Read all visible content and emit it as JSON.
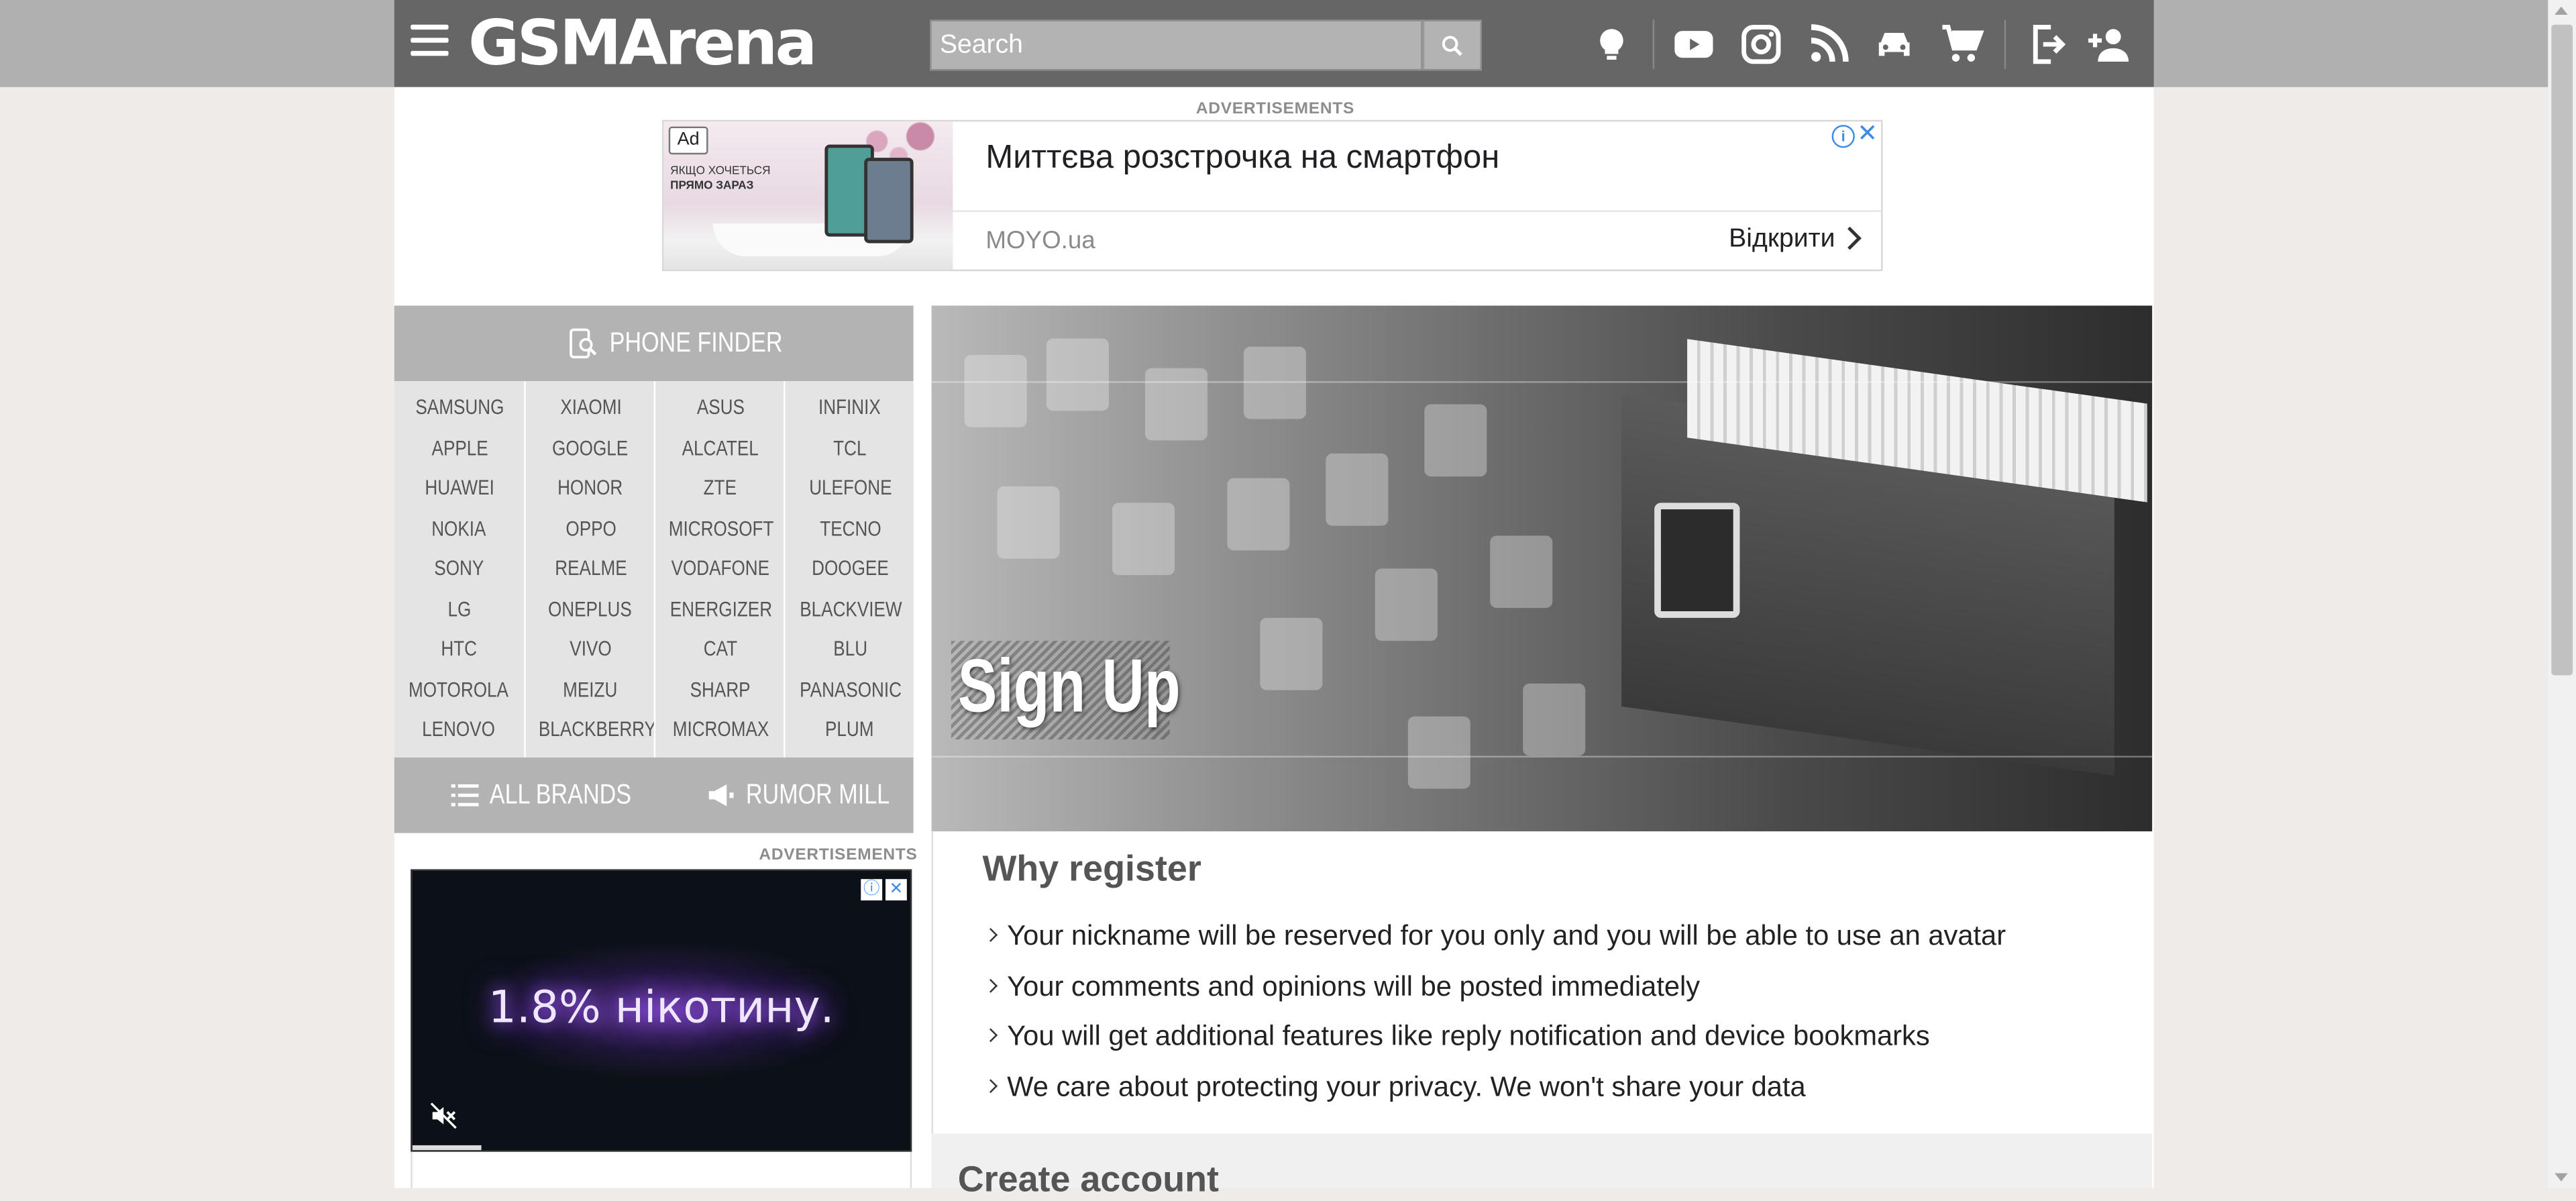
{
  "header": {
    "logo_text": "GSMArena",
    "search_placeholder": "Search",
    "icons": [
      "menu-icon",
      "search-icon",
      "lightbulb-icon",
      "youtube-icon",
      "instagram-icon",
      "rss-icon",
      "car-icon",
      "cart-icon",
      "login-icon",
      "add-user-icon"
    ]
  },
  "top_ad": {
    "label": "ADVERTISEMENTS",
    "badge": "Ad",
    "image_caption_line1": "ЯКЩО ХОЧЕТЬСЯ",
    "image_caption_line2": "ПРЯМО ЗАРАЗ",
    "headline": "Миттєва розстрочка на смартфон",
    "domain": "MOYO.ua",
    "cta": "Відкрити",
    "info": "i",
    "close": "✕"
  },
  "sidebar": {
    "phone_finder": "PHONE FINDER",
    "brand_columns": [
      [
        "SAMSUNG",
        "APPLE",
        "HUAWEI",
        "NOKIA",
        "SONY",
        "LG",
        "HTC",
        "MOTOROLA",
        "LENOVO"
      ],
      [
        "XIAOMI",
        "GOOGLE",
        "HONOR",
        "OPPO",
        "REALME",
        "ONEPLUS",
        "VIVO",
        "MEIZU",
        "BLACKBERRY"
      ],
      [
        "ASUS",
        "ALCATEL",
        "ZTE",
        "MICROSOFT",
        "VODAFONE",
        "ENERGIZER",
        "CAT",
        "SHARP",
        "MICROMAX"
      ],
      [
        "INFINIX",
        "TCL",
        "ULEFONE",
        "TECNO",
        "DOOGEE",
        "BLACKVIEW",
        "BLU",
        "PANASONIC",
        "PLUM"
      ]
    ],
    "all_brands": "ALL BRANDS",
    "rumor_mill": "RUMOR MILL",
    "ad_label": "ADVERTISEMENTS",
    "side_ad_text": "1.8% нікотину."
  },
  "hero": {
    "title": "Sign Up"
  },
  "why_register": {
    "title": "Why register",
    "items": [
      "Your nickname will be reserved for you only and you will be able to use an avatar",
      "Your comments and opinions will be posted immediately",
      "You will get additional features like reply notification and device bookmarks",
      "We care about protecting your privacy. We won't share your data"
    ]
  },
  "create_account": {
    "title": "Create account"
  },
  "colors": {
    "header_bg": "#666666",
    "band_bg": "#b0b0b0",
    "page_bg": "#efebe9",
    "panel_grey": "#b3b3b3",
    "brand_list_bg": "#e4e4e4"
  }
}
